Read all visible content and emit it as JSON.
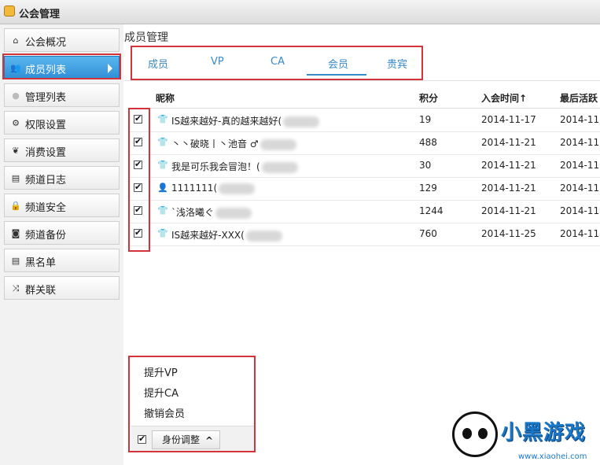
{
  "window": {
    "title": "公会管理"
  },
  "sidebar": {
    "items": [
      {
        "label": "公会概况",
        "icon": "home-icon"
      },
      {
        "label": "成员列表",
        "icon": "users-icon",
        "active": true
      },
      {
        "label": "管理列表",
        "icon": "user-icon"
      },
      {
        "label": "权限设置",
        "icon": "gear-icon"
      },
      {
        "label": "消费设置",
        "icon": "leaf-icon"
      },
      {
        "label": "频道日志",
        "icon": "list-icon"
      },
      {
        "label": "频道安全",
        "icon": "lock-icon"
      },
      {
        "label": "频道备份",
        "icon": "camera-icon"
      },
      {
        "label": "黑名单",
        "icon": "list-icon"
      },
      {
        "label": "群关联",
        "icon": "shuffle-icon"
      }
    ]
  },
  "main": {
    "title": "成员管理",
    "tabs": [
      {
        "label": "成员"
      },
      {
        "label": "VP"
      },
      {
        "label": "CA"
      },
      {
        "label": "会员",
        "active": true
      },
      {
        "label": "贵宾"
      }
    ]
  },
  "table": {
    "headers": {
      "nickname": "昵称",
      "points": "积分",
      "joined": "入会时间",
      "last": "最后活跃"
    },
    "rows": [
      {
        "nickname": "IS越来越好-真的越来越好(",
        "points": "19",
        "joined": "2014-11-17",
        "last": "2014-11"
      },
      {
        "nickname": "丶丶破晓丨丶池音 ♂",
        "points": "488",
        "joined": "2014-11-21",
        "last": "2014-11"
      },
      {
        "nickname": "我是可乐我会冒泡！(",
        "points": "30",
        "joined": "2014-11-21",
        "last": "2014-11"
      },
      {
        "nickname": "1111111(",
        "points": "129",
        "joined": "2014-11-21",
        "last": "2014-11"
      },
      {
        "nickname": "`浅洛曦ぐ",
        "points": "1244",
        "joined": "2014-11-21",
        "last": "2014-11"
      },
      {
        "nickname": "IS越来越好-XXX(",
        "points": "760",
        "joined": "2014-11-25",
        "last": "2014-11"
      }
    ]
  },
  "actions": {
    "items": [
      "提升VP",
      "提升CA",
      "撤销会员"
    ],
    "role_button": "身份调整"
  },
  "watermark": {
    "text": "小黑游戏",
    "url": "www.xiaohei.com"
  },
  "colors": {
    "accent": "#3a8ac8",
    "active_bg": "#2f8fd6",
    "highlight_box": "#d3343a"
  }
}
